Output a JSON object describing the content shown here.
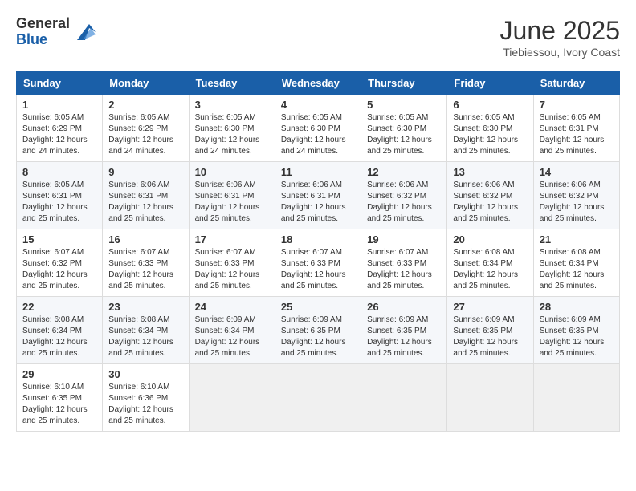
{
  "header": {
    "logo_general": "General",
    "logo_blue": "Blue",
    "month_title": "June 2025",
    "location": "Tiebiessou, Ivory Coast"
  },
  "weekdays": [
    "Sunday",
    "Monday",
    "Tuesday",
    "Wednesday",
    "Thursday",
    "Friday",
    "Saturday"
  ],
  "weeks": [
    [
      {
        "day": "1",
        "sunrise": "6:05 AM",
        "sunset": "6:29 PM",
        "daylight": "12 hours and 24 minutes."
      },
      {
        "day": "2",
        "sunrise": "6:05 AM",
        "sunset": "6:29 PM",
        "daylight": "12 hours and 24 minutes."
      },
      {
        "day": "3",
        "sunrise": "6:05 AM",
        "sunset": "6:30 PM",
        "daylight": "12 hours and 24 minutes."
      },
      {
        "day": "4",
        "sunrise": "6:05 AM",
        "sunset": "6:30 PM",
        "daylight": "12 hours and 24 minutes."
      },
      {
        "day": "5",
        "sunrise": "6:05 AM",
        "sunset": "6:30 PM",
        "daylight": "12 hours and 25 minutes."
      },
      {
        "day": "6",
        "sunrise": "6:05 AM",
        "sunset": "6:30 PM",
        "daylight": "12 hours and 25 minutes."
      },
      {
        "day": "7",
        "sunrise": "6:05 AM",
        "sunset": "6:31 PM",
        "daylight": "12 hours and 25 minutes."
      }
    ],
    [
      {
        "day": "8",
        "sunrise": "6:05 AM",
        "sunset": "6:31 PM",
        "daylight": "12 hours and 25 minutes."
      },
      {
        "day": "9",
        "sunrise": "6:06 AM",
        "sunset": "6:31 PM",
        "daylight": "12 hours and 25 minutes."
      },
      {
        "day": "10",
        "sunrise": "6:06 AM",
        "sunset": "6:31 PM",
        "daylight": "12 hours and 25 minutes."
      },
      {
        "day": "11",
        "sunrise": "6:06 AM",
        "sunset": "6:31 PM",
        "daylight": "12 hours and 25 minutes."
      },
      {
        "day": "12",
        "sunrise": "6:06 AM",
        "sunset": "6:32 PM",
        "daylight": "12 hours and 25 minutes."
      },
      {
        "day": "13",
        "sunrise": "6:06 AM",
        "sunset": "6:32 PM",
        "daylight": "12 hours and 25 minutes."
      },
      {
        "day": "14",
        "sunrise": "6:06 AM",
        "sunset": "6:32 PM",
        "daylight": "12 hours and 25 minutes."
      }
    ],
    [
      {
        "day": "15",
        "sunrise": "6:07 AM",
        "sunset": "6:32 PM",
        "daylight": "12 hours and 25 minutes."
      },
      {
        "day": "16",
        "sunrise": "6:07 AM",
        "sunset": "6:33 PM",
        "daylight": "12 hours and 25 minutes."
      },
      {
        "day": "17",
        "sunrise": "6:07 AM",
        "sunset": "6:33 PM",
        "daylight": "12 hours and 25 minutes."
      },
      {
        "day": "18",
        "sunrise": "6:07 AM",
        "sunset": "6:33 PM",
        "daylight": "12 hours and 25 minutes."
      },
      {
        "day": "19",
        "sunrise": "6:07 AM",
        "sunset": "6:33 PM",
        "daylight": "12 hours and 25 minutes."
      },
      {
        "day": "20",
        "sunrise": "6:08 AM",
        "sunset": "6:34 PM",
        "daylight": "12 hours and 25 minutes."
      },
      {
        "day": "21",
        "sunrise": "6:08 AM",
        "sunset": "6:34 PM",
        "daylight": "12 hours and 25 minutes."
      }
    ],
    [
      {
        "day": "22",
        "sunrise": "6:08 AM",
        "sunset": "6:34 PM",
        "daylight": "12 hours and 25 minutes."
      },
      {
        "day": "23",
        "sunrise": "6:08 AM",
        "sunset": "6:34 PM",
        "daylight": "12 hours and 25 minutes."
      },
      {
        "day": "24",
        "sunrise": "6:09 AM",
        "sunset": "6:34 PM",
        "daylight": "12 hours and 25 minutes."
      },
      {
        "day": "25",
        "sunrise": "6:09 AM",
        "sunset": "6:35 PM",
        "daylight": "12 hours and 25 minutes."
      },
      {
        "day": "26",
        "sunrise": "6:09 AM",
        "sunset": "6:35 PM",
        "daylight": "12 hours and 25 minutes."
      },
      {
        "day": "27",
        "sunrise": "6:09 AM",
        "sunset": "6:35 PM",
        "daylight": "12 hours and 25 minutes."
      },
      {
        "day": "28",
        "sunrise": "6:09 AM",
        "sunset": "6:35 PM",
        "daylight": "12 hours and 25 minutes."
      }
    ],
    [
      {
        "day": "29",
        "sunrise": "6:10 AM",
        "sunset": "6:35 PM",
        "daylight": "12 hours and 25 minutes."
      },
      {
        "day": "30",
        "sunrise": "6:10 AM",
        "sunset": "6:36 PM",
        "daylight": "12 hours and 25 minutes."
      },
      null,
      null,
      null,
      null,
      null
    ]
  ],
  "labels": {
    "sunrise": "Sunrise:",
    "sunset": "Sunset:",
    "daylight": "Daylight:"
  }
}
